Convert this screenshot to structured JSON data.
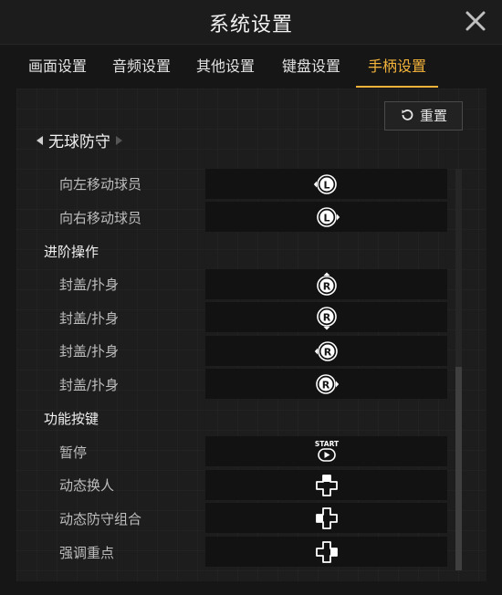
{
  "window": {
    "title": "系统设置"
  },
  "tabs": [
    {
      "label": "画面设置",
      "active": false
    },
    {
      "label": "音频设置",
      "active": false
    },
    {
      "label": "其他设置",
      "active": false
    },
    {
      "label": "键盘设置",
      "active": false
    },
    {
      "label": "手柄设置",
      "active": true
    }
  ],
  "accent_color": "#f3b33a",
  "reset_label": "重置",
  "mode": {
    "label": "无球防守"
  },
  "sections": {
    "advanced": "进阶操作",
    "function": "功能按键"
  },
  "rows": [
    {
      "label": "向左移动球员",
      "icon": "left-stick-left-icon"
    },
    {
      "label": "向右移动球员",
      "icon": "left-stick-right-icon"
    },
    {
      "label": "封盖/扑身",
      "icon": "right-stick-up-icon"
    },
    {
      "label": "封盖/扑身",
      "icon": "right-stick-down-icon"
    },
    {
      "label": "封盖/扑身",
      "icon": "right-stick-left-icon"
    },
    {
      "label": "封盖/扑身",
      "icon": "right-stick-right-icon"
    },
    {
      "label": "暂停",
      "icon": "start-button-icon"
    },
    {
      "label": "动态换人",
      "icon": "dpad-up-icon"
    },
    {
      "label": "动态防守组合",
      "icon": "dpad-left-icon"
    },
    {
      "label": "强调重点",
      "icon": "dpad-right-icon"
    }
  ],
  "start_text": "START"
}
